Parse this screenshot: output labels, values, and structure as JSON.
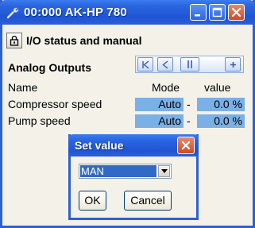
{
  "window": {
    "title": "00:000 AK-HP 780"
  },
  "toolbar": {
    "section_title": "I/O status and manual"
  },
  "analog": {
    "title": "Analog Outputs"
  },
  "table": {
    "headers": {
      "name": "Name",
      "mode": "Mode",
      "value": "value"
    },
    "rows": [
      {
        "name": "Compressor speed",
        "mode": "Auto",
        "sep": "-",
        "value": "0.0 %"
      },
      {
        "name": "Pump speed",
        "mode": "Auto",
        "sep": "-",
        "value": "0.0 %"
      }
    ]
  },
  "dialog": {
    "title": "Set value",
    "select_value": "MAN",
    "ok_label": "OK",
    "cancel_label": "Cancel"
  },
  "colors": {
    "titlebar": "#2a64e0",
    "cell_highlight": "#7ab0e6",
    "close": "#cf4a24",
    "background": "#f3f1e8"
  }
}
